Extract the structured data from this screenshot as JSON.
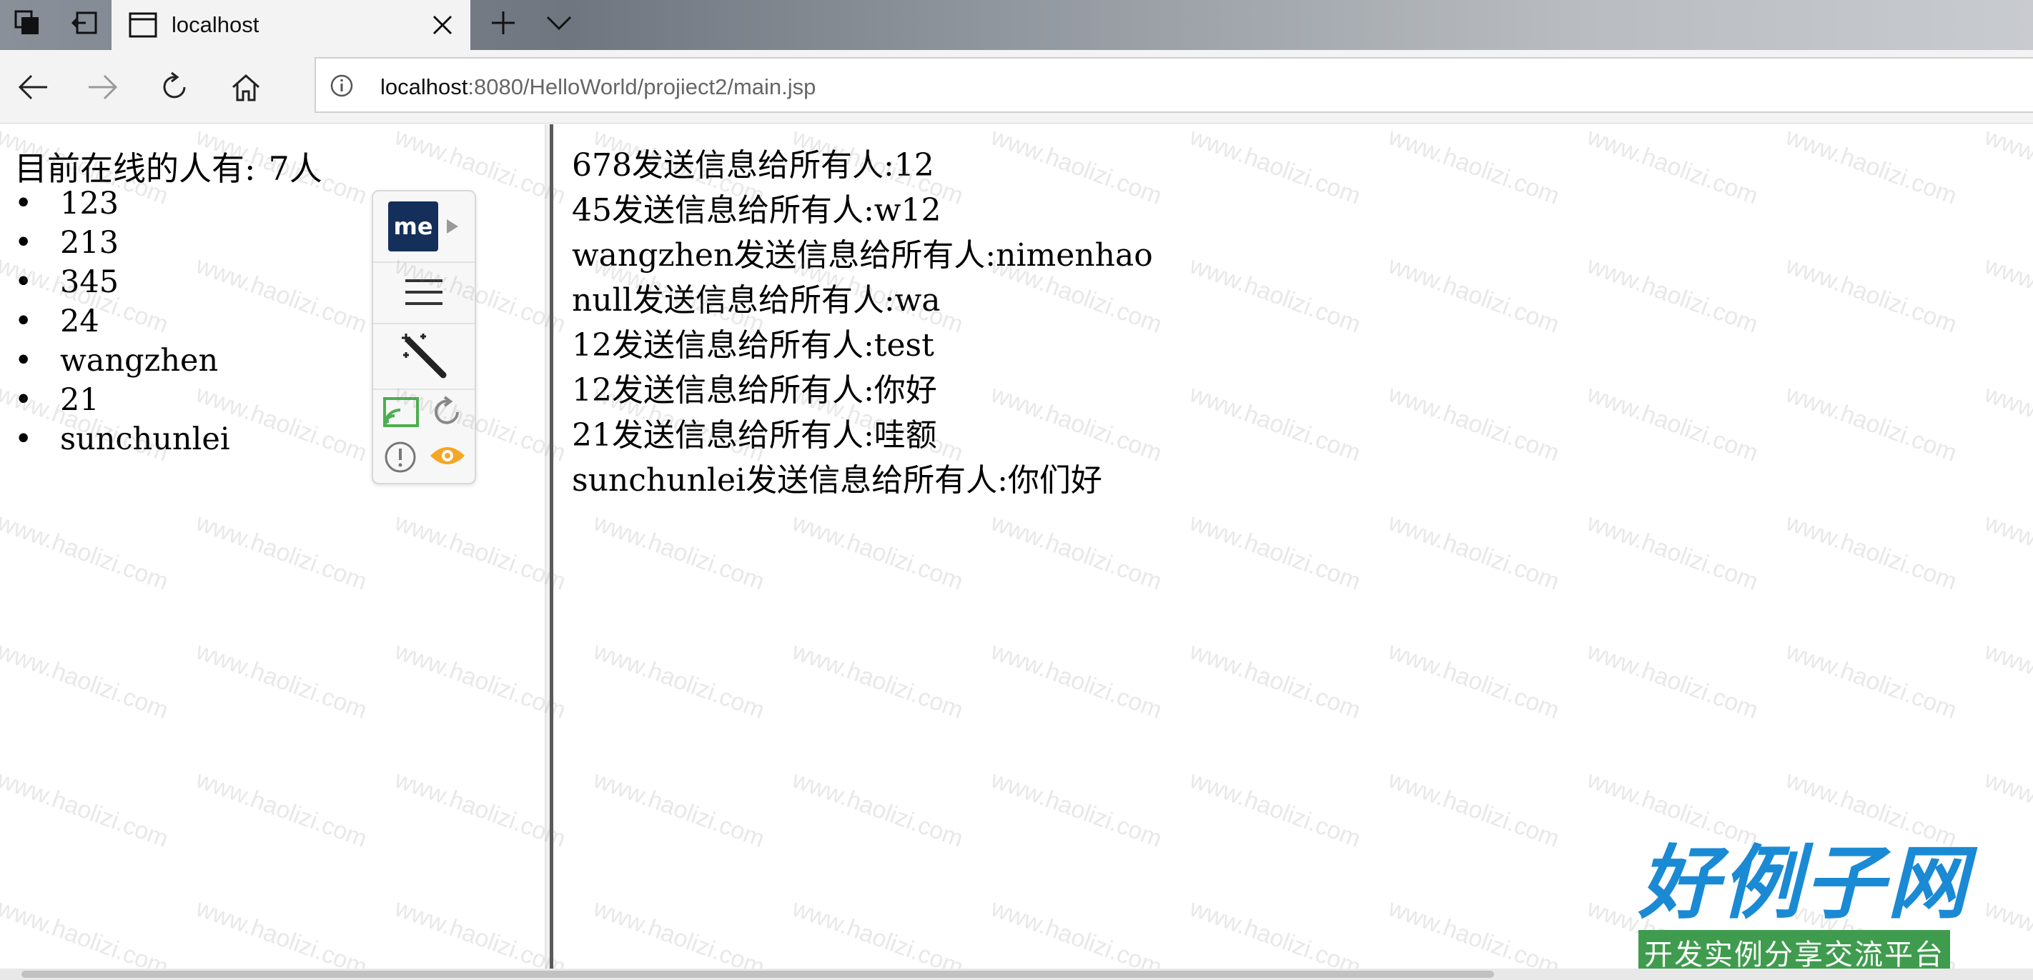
{
  "browser": {
    "tab_title": "localhost",
    "url": {
      "host": "localhost",
      "rest": ":8080/HelloWorld/projiect2/main.jsp"
    }
  },
  "online": {
    "header_label": "目前在线的人有:",
    "count_label": "7人",
    "users": [
      "123",
      "213",
      "345",
      "24",
      "wangzhen",
      "21",
      "sunchunlei"
    ]
  },
  "messages": [
    "678发送信息给所有人:12",
    "45发送信息给所有人:w12",
    "wangzhen发送信息给所有人:nimenhao",
    "null发送信息给所有人:wa",
    "12发送信息给所有人:test",
    "12发送信息给所有人:你好",
    "21发送信息给所有人:哇额",
    "sunchunlei发送信息给所有人:你们好"
  ],
  "extension": {
    "logo_text": "me"
  },
  "watermark": {
    "text": "www.haolizi.com",
    "brand_title": "好例子网",
    "brand_subtitle": "开发实例分享交流平台"
  },
  "colors": {
    "brand_blue": "#1a8ad4",
    "brand_green": "#3f9c4e",
    "ext_logo_bg": "#14305a",
    "cast_green": "#4caf50",
    "eye_orange": "#f5a623"
  }
}
